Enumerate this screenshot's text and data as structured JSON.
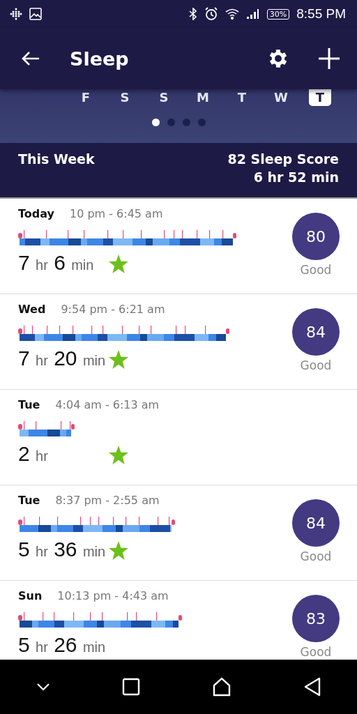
{
  "status_bar": {
    "battery": "30%",
    "time": "8:55 PM"
  },
  "header": {
    "title": "Sleep"
  },
  "week_days": [
    {
      "label": "F",
      "selected": false
    },
    {
      "label": "S",
      "selected": false
    },
    {
      "label": "S",
      "selected": false
    },
    {
      "label": "M",
      "selected": false
    },
    {
      "label": "T",
      "selected": false
    },
    {
      "label": "W",
      "selected": false
    },
    {
      "label": "T",
      "selected": true
    }
  ],
  "pager_dots": [
    {
      "selected": true
    },
    {
      "selected": false
    },
    {
      "selected": false
    },
    {
      "selected": false
    }
  ],
  "summary": {
    "label": "This Week",
    "score": "82 Sleep Score",
    "duration": "6 hr 52 min"
  },
  "sleep_logs": [
    {
      "day": "Today",
      "time_range": "10 pm - 6:45 am",
      "duration": [
        {
          "number": "7",
          "unit": "hr"
        },
        {
          "number": "6",
          "unit": "min"
        }
      ],
      "star": true,
      "score": "80",
      "rating": "Good"
    },
    {
      "day": "Wed",
      "time_range": "9:54 pm - 6:21 am",
      "duration": [
        {
          "number": "7",
          "unit": "hr"
        },
        {
          "number": "20",
          "unit": "min"
        }
      ],
      "star": true,
      "score": "84",
      "rating": "Good"
    },
    {
      "day": "Tue",
      "time_range": "4:04 am - 6:13 am",
      "duration": [
        {
          "number": "2",
          "unit": "hr"
        }
      ],
      "star": true
    },
    {
      "day": "Tue",
      "time_range": "8:37 pm - 2:55 am",
      "duration": [
        {
          "number": "5",
          "unit": "hr"
        },
        {
          "number": "36",
          "unit": "min"
        }
      ],
      "star": true,
      "score": "84",
      "rating": "Good"
    },
    {
      "day": "Sun",
      "time_range": "10:13 pm - 4:43 am",
      "duration": [
        {
          "number": "5",
          "unit": "hr"
        },
        {
          "number": "26",
          "unit": "min"
        }
      ],
      "star": false,
      "score": "83",
      "rating": "Good"
    }
  ]
}
